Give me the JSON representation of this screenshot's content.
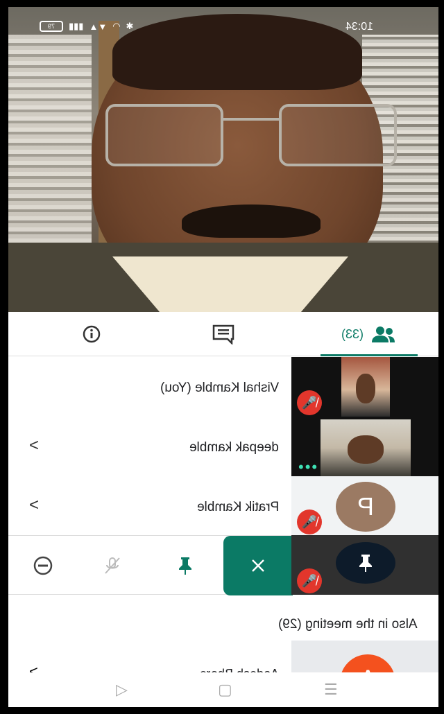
{
  "status_bar": {
    "time": "10:34",
    "battery": "79"
  },
  "tabs": {
    "people_count": "(33)"
  },
  "participants": [
    {
      "name": "Vishal Kamble (You)"
    },
    {
      "name": "deepak kamble"
    },
    {
      "name": "Pratik Kamble",
      "avatar_letter": "P"
    }
  ],
  "section": {
    "title": "Also in the meeting (29)"
  },
  "partial_row": {
    "name": "Aadesh Bhore",
    "avatar_letter": "A"
  },
  "colors": {
    "accent": "#0b7a65",
    "mic_off": "#e2362c",
    "avatar_a": "#f4511e"
  },
  "icons": {
    "info": "info-icon",
    "chat": "chat-icon",
    "people": "people-icon",
    "pin": "pin-icon",
    "mic_off": "mic-off-icon",
    "remove": "remove-icon",
    "close": "close-icon"
  }
}
